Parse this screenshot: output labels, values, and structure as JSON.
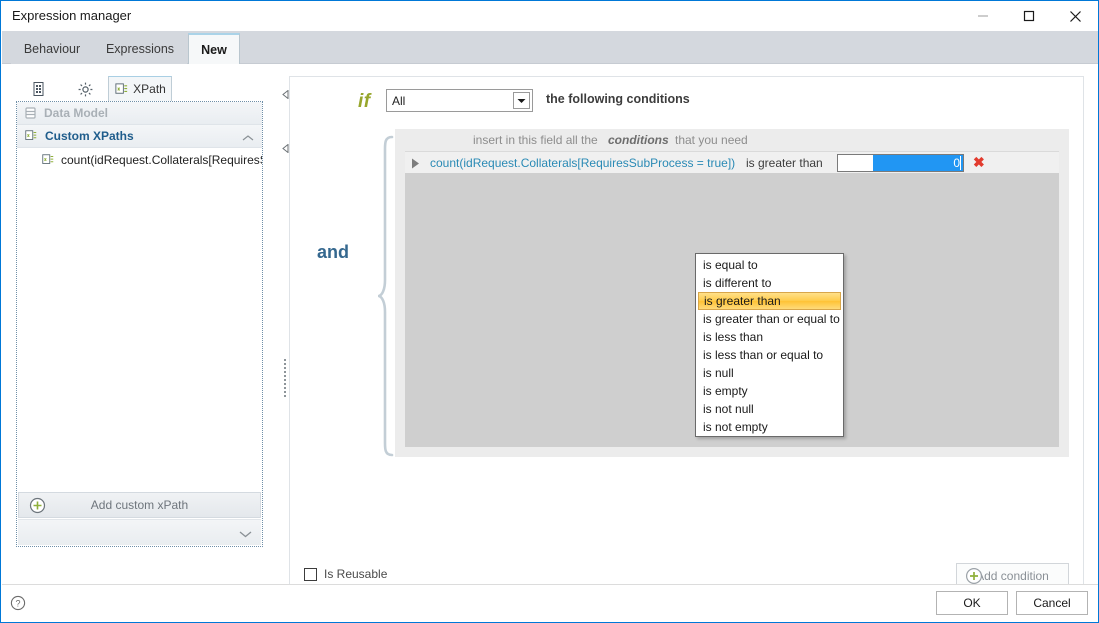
{
  "window": {
    "title": "Expression manager",
    "controls": [
      {
        "name": "minimize",
        "glyph": "minimize-icon"
      },
      {
        "name": "maximize",
        "glyph": "maximize-icon"
      },
      {
        "name": "close",
        "glyph": "close-icon"
      }
    ]
  },
  "tabs": [
    {
      "label": "Behaviour",
      "active": false
    },
    {
      "label": "Expressions",
      "active": false
    },
    {
      "label": "New",
      "active": true
    }
  ],
  "sidebar": {
    "tabs": [
      {
        "label": "",
        "icon": "document-icon",
        "active": false
      },
      {
        "label": "",
        "icon": "gear-icon",
        "active": false
      },
      {
        "label": "XPath",
        "icon": "xpath-icon",
        "active": true
      }
    ],
    "tree": [
      {
        "label": "Data Model",
        "icon": "database-icon",
        "state": "disabled",
        "level": 0
      },
      {
        "label": "Custom XPaths",
        "icon": "xpath-icon",
        "state": "active",
        "level": 0,
        "caret": "chevron-up-icon"
      },
      {
        "label": "count(idRequest.Collaterals[RequiresS",
        "icon": "xpath-icon",
        "state": "normal",
        "level": 1
      }
    ],
    "add_button_label": "Add custom xPath",
    "scroll_down_icon": "chevron-down-icon"
  },
  "main": {
    "if_word": "if",
    "scope_select": {
      "value": "All",
      "arrow": "chevron-down-icon"
    },
    "following_text": "the following conditions",
    "group_operator": "and",
    "hint": {
      "part1": "insert in this field all the",
      "part2": "conditions",
      "part3": "that you need"
    },
    "condition": {
      "expander_icon": "expander-triangle-icon",
      "xpath": "count(idRequest.Collaterals[RequiresSubProcess = true])",
      "operator": "is greater than",
      "value": "0",
      "delete_icon": "delete-x-icon"
    },
    "operator_dropdown": {
      "selected": "is greater than",
      "options": [
        "is equal to",
        "is different to",
        "is greater than",
        "is greater than or equal to",
        "is less than",
        "is less than or equal to",
        "is null",
        "is empty",
        "is not null",
        "is not empty"
      ]
    },
    "is_reusable": {
      "label": "Is Reusable",
      "checked": false
    },
    "add_condition_label": "Add condition"
  },
  "footer": {
    "help_icon": "help-icon",
    "ok_label": "OK",
    "cancel_label": "Cancel"
  },
  "colors": {
    "accent": "#0078d7",
    "if_olive": "#97a62c",
    "and_blue": "#35688f",
    "xpath_cyan": "#2a8ab5",
    "selection_blue": "#2196f3",
    "highlight_amber": "#ffcc4d",
    "delete_red": "#e23b2e"
  }
}
